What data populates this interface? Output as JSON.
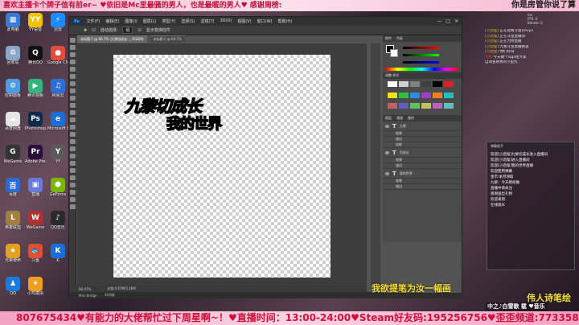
{
  "ticker_top": {
    "text": "喜欢主播卡个牌子信有前er~        ♥依旧是Mc里最骚的男人，也是最暖的男人♥    感谢周榜:",
    "right_text": "你是房管你说了算"
  },
  "ticker_bottom": {
    "text": "807675434♥有能力的大佬帮忙过下周星啊~！♥直播时间：13:00-24:00♥Steam好友码:195256756♥歪歪频道:7733584"
  },
  "desktop_icons": [
    {
      "label": "此电脑",
      "color": "#3a7bd5",
      "glyph": "▦"
    },
    {
      "label": "YY语音",
      "color": "#f2c200",
      "glyph": "YY"
    },
    {
      "label": "迅雷",
      "color": "#1a8cff",
      "glyph": "⚡"
    },
    {
      "label": "回收站",
      "color": "#8aa6c8",
      "glyph": "♻"
    },
    {
      "label": "腾讯QQ",
      "color": "#111",
      "glyph": "Q"
    },
    {
      "label": "Google Chrome",
      "color": "#e24c3a",
      "glyph": "●"
    },
    {
      "label": "控制面板",
      "color": "#4d9be0",
      "glyph": "⚙"
    },
    {
      "label": "腾讯视频",
      "color": "#30b67c",
      "glyph": "▶"
    },
    {
      "label": "网易云",
      "color": "#2d6fd8",
      "glyph": "♫"
    },
    {
      "label": "百度网盘",
      "color": "#e5e5e5",
      "glyph": "☁"
    },
    {
      "label": "Photoshop",
      "color": "#0d2a4d",
      "glyph": "Ps"
    },
    {
      "label": "Microsoft Edge",
      "color": "#1a6ed8",
      "glyph": "e"
    },
    {
      "label": "WeGame",
      "color": "#333",
      "glyph": "G"
    },
    {
      "label": "Adobe Premiere",
      "color": "#2a0f3d",
      "glyph": "Pr"
    },
    {
      "label": "YY",
      "color": "#5a5a5a",
      "glyph": "Y"
    },
    {
      "label": "百度",
      "color": "#2a6bd8",
      "glyph": "百"
    },
    {
      "label": "直播",
      "color": "#6a7ad8",
      "glyph": "▣"
    },
    {
      "label": "GeForce",
      "color": "#76b900",
      "glyph": "⬢"
    },
    {
      "label": "英雄联盟",
      "color": "#a08040",
      "glyph": "L"
    },
    {
      "label": "WeGame",
      "color": "#b43030",
      "glyph": "W"
    },
    {
      "label": "QQ音乐",
      "color": "#2a2a2a",
      "glyph": "♪"
    },
    {
      "label": "光荣使命",
      "color": "#e0a020",
      "glyph": "★"
    },
    {
      "label": "斗鱼",
      "color": "#e05030",
      "glyph": "🐟"
    },
    {
      "label": "K",
      "color": "#1a6ed8",
      "glyph": "K"
    },
    {
      "label": "QQ",
      "color": "#1a7ae0",
      "glyph": "♟"
    },
    {
      "label": "小鸡模拟",
      "color": "#f0a020",
      "glyph": "✦"
    }
  ],
  "photoshop": {
    "menus": [
      "文件(F)",
      "编辑(E)",
      "图像(I)",
      "图层(L)",
      "类型(Y)",
      "选择(S)",
      "滤镜(T)",
      "3D(D)",
      "视图(V)",
      "窗口(W)",
      "帮助(H)"
    ],
    "options": {
      "auto_select": "自动选择:",
      "auto_select_value": "组",
      "transform": "显示变换控件"
    },
    "tabs": [
      {
        "label": "未标题-1 @ 66.7% (九黎切成长..., RGB/8)",
        "active": true
      },
      {
        "label": "未标题-2 @ 66.7%",
        "active": false
      }
    ],
    "artwork": {
      "line1_red": "九黎",
      "line1_blue": "切成长",
      "line2": "我的世界"
    },
    "status": {
      "zoom": "66.67%",
      "doc": "文档:4.67M/5.26M"
    },
    "minibridge": [
      "Mini Bridge",
      "时间轴"
    ],
    "panel_tabs": [
      "颜色",
      "色板"
    ],
    "swatch_title": "调整  样式",
    "layers_header": [
      "图层",
      "通道",
      "路径"
    ],
    "layers": [
      {
        "name": "九黎",
        "type": "T",
        "effects": [
          "效果",
          "描边",
          "投影"
        ]
      },
      {
        "name": "切成长",
        "type": "T",
        "effects": [
          "效果",
          "描边"
        ]
      },
      {
        "name": "我的世界",
        "type": "T",
        "effects": [
          "效果",
          "描边"
        ]
      }
    ]
  },
  "chat": {
    "lines": [
      {
        "who": "[小酒鬼]:",
        "text": "正在观看斗鱼Douyu"
      },
      {
        "who": "[小酒鬼]:",
        "text": "正在斗鱼直播间"
      },
      {
        "who": "[小酒鬼]:",
        "text": "正在为你直播"
      },
      {
        "who": "[小酒鬼]:",
        "text": "九黎斗鱼直播频道"
      },
      {
        "who": "[小酒鬼]:",
        "text": "你们好呀"
      },
      {
        "who": "九黎:",
        "text": "今天做个logo给大家"
      },
      {
        "who": "",
        "text": "自动查看我的小鱼丸"
      }
    ],
    "stats": [
      "ms",
      "FPS: 0",
      "Bitrate: 0"
    ]
  },
  "cam": {
    "header": "弹幕助手",
    "lines": [
      "欢迎[小酒鬼]九黎切成长进入直播间",
      "欢迎[小酒鬼]进入直播间",
      "欢迎[小酒鬼]我的世界直播",
      "欢迎使用弹幕",
      "金币:本月领取",
      "九黎：今天继续做",
      "直播中请关注",
      "感谢送出礼物",
      "欢迎来到",
      "在线观众"
    ]
  },
  "captions": {
    "main": "我欲提笔为汝一幅画",
    "secondary": "伟人诗笔绘",
    "watermark": "中之♪白雪歌 载 ♥音乐"
  },
  "colors": {
    "accent_red": "#e02020",
    "accent_blue": "#2a8de0",
    "accent_yellow": "#f2e018",
    "ticker_pink": "#f6b8d0"
  }
}
